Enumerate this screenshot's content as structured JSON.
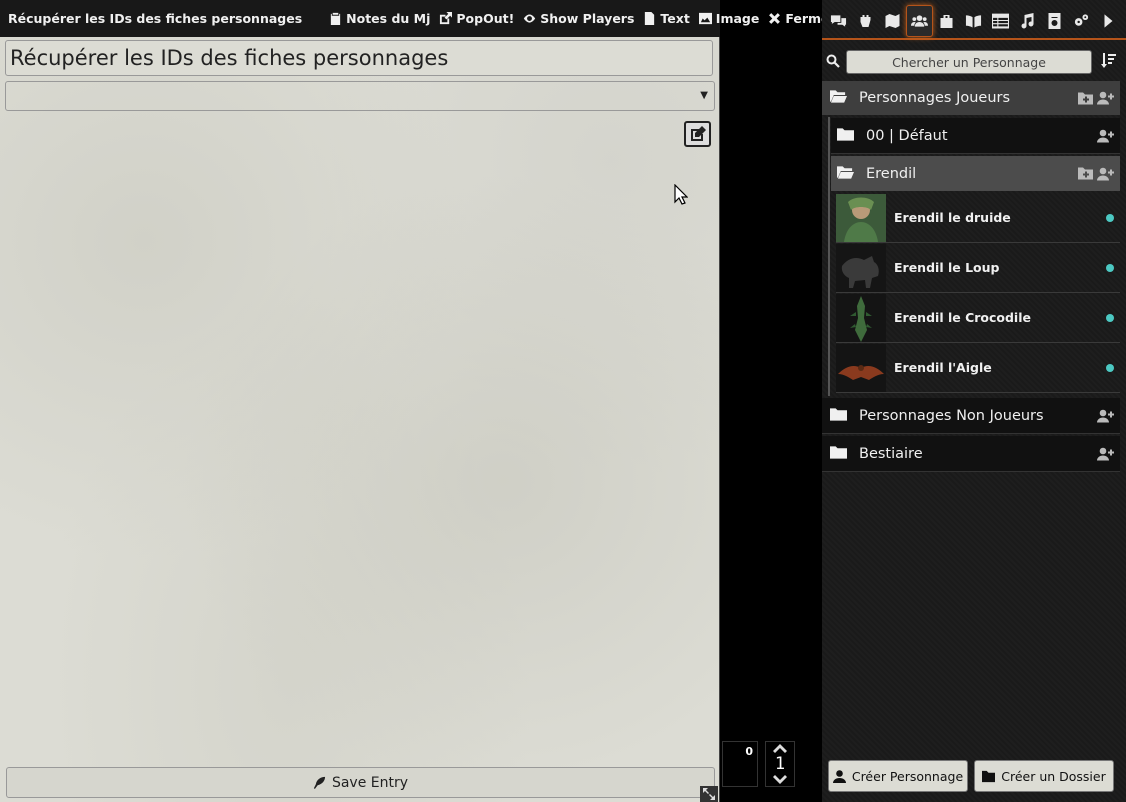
{
  "journal": {
    "header": {
      "title": "Récupérer les IDs des fiches personnages",
      "buttons": [
        {
          "label": "Notes du Mj",
          "icon": "clipboard-icon"
        },
        {
          "label": "PopOut!",
          "icon": "external-link-icon"
        },
        {
          "label": "Show Players",
          "icon": "eye-icon"
        },
        {
          "label": "Text",
          "icon": "file-text-icon"
        },
        {
          "label": "Image",
          "icon": "image-icon"
        },
        {
          "label": "Fermer",
          "icon": "close-icon"
        }
      ]
    },
    "title_value": "Récupérer les IDs des fiches personnages",
    "folder_value": "",
    "save_label": "Save Entry"
  },
  "page_widget": {
    "count": "0",
    "current": "1"
  },
  "sidebar": {
    "search_placeholder": "Chercher un Personnage",
    "folders": {
      "pj": "Personnages Joueurs",
      "default": "00 | Défaut",
      "erendil": "Erendil",
      "pnj": "Personnages Non Joueurs",
      "bestiaire": "Bestiaire"
    },
    "characters": [
      {
        "name": "Erendil le druide",
        "status_color": "#4cc9c3"
      },
      {
        "name": "Erendil le Loup",
        "status_color": "#4cc9c3"
      },
      {
        "name": "Erendil le Crocodile",
        "status_color": "#4cc9c3"
      },
      {
        "name": "Erendil l'Aigle",
        "status_color": "#4cc9c3"
      }
    ],
    "footer": {
      "create_character": "Créer Personnage",
      "create_folder": "Créer un Dossier"
    },
    "active_tab": "actors-tab",
    "accent_color": "#b5541a"
  }
}
